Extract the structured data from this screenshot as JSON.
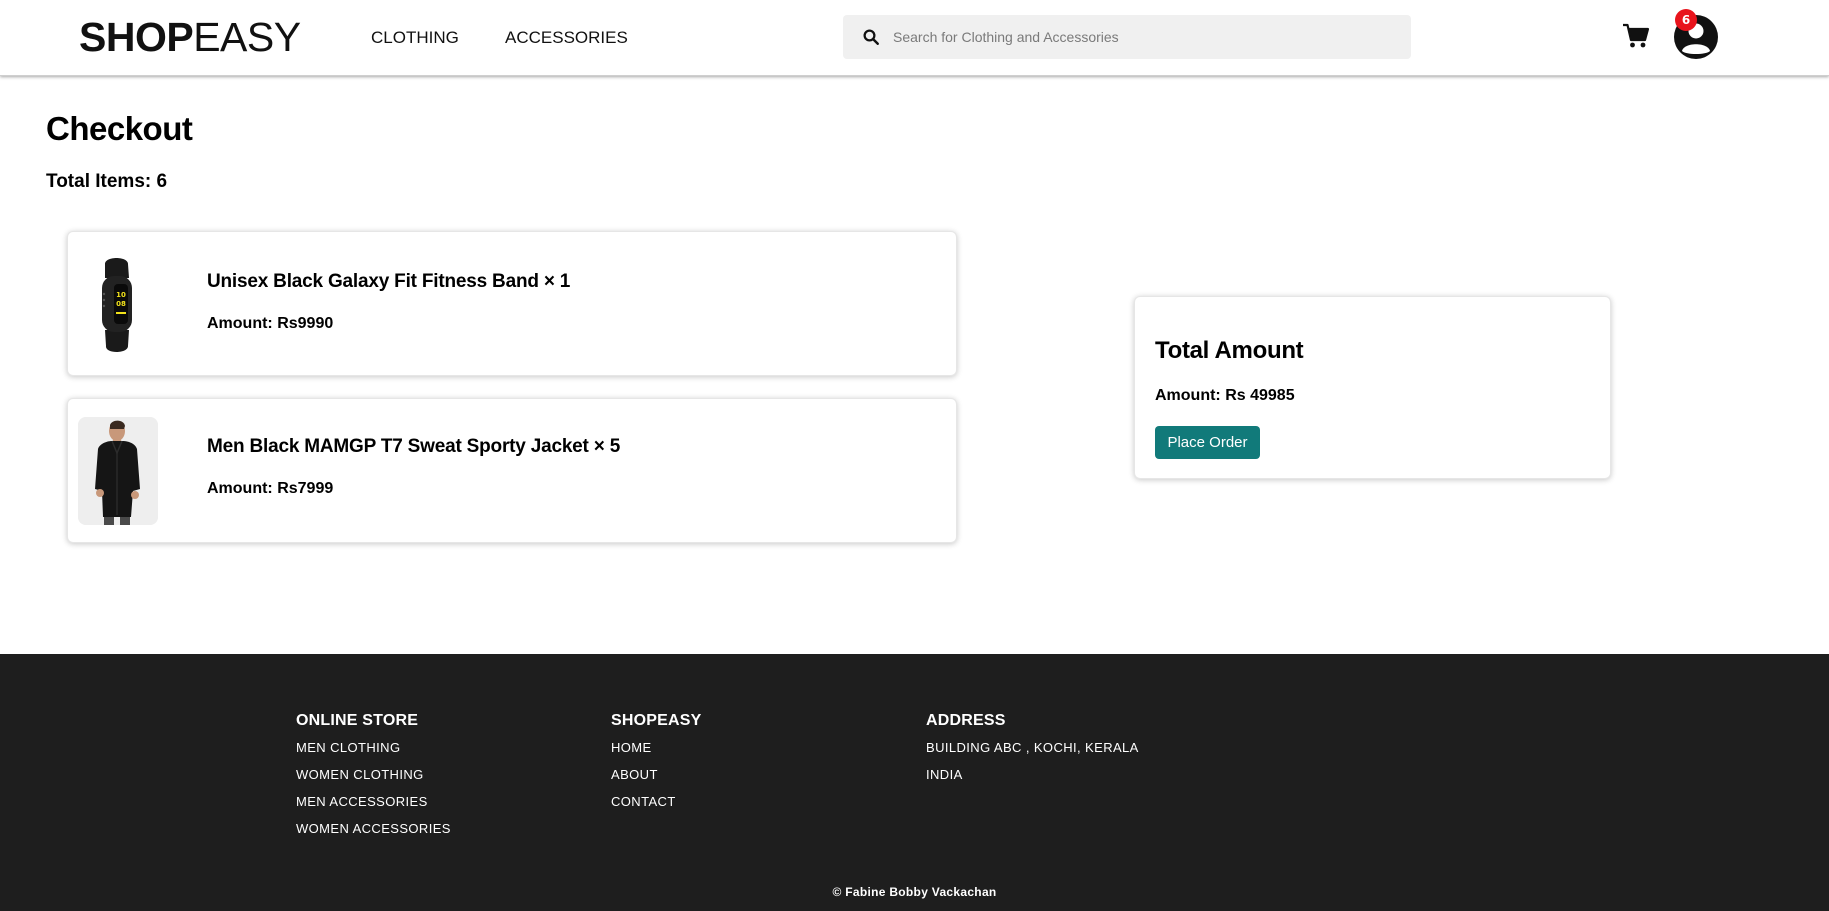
{
  "header": {
    "logo_bold": "SHOP",
    "logo_light": "EASY",
    "nav": [
      "CLOTHING",
      "ACCESSORIES"
    ],
    "search_placeholder": "Search for Clothing and Accessories",
    "cart_icon": "shopping-cart-icon",
    "profile_icon": "user-circle-icon",
    "badge_count": "6"
  },
  "main": {
    "title": "Checkout",
    "total_items": "Total Items: 6",
    "items": [
      {
        "name": "Unisex Black Galaxy Fit Fitness Band × 1",
        "amount": "Amount: Rs9990",
        "image": "fitness-band"
      },
      {
        "name": "Men Black MAMGP T7 Sweat Sporty Jacket × 5",
        "amount": "Amount: Rs7999",
        "image": "jacket"
      }
    ],
    "summary": {
      "title": "Total Amount",
      "amount": "Amount: Rs 49985",
      "button": "Place Order"
    }
  },
  "footer": {
    "online_store": {
      "heading": "ONLINE STORE",
      "links": [
        "MEN CLOTHING",
        "WOMEN CLOTHING",
        "MEN ACCESSORIES",
        "WOMEN ACCESSORIES"
      ]
    },
    "shopeasy": {
      "heading": "SHOPEASY",
      "links": [
        "HOME",
        "ABOUT",
        "CONTACT"
      ]
    },
    "address": {
      "heading": "ADDRESS",
      "lines": [
        "BUILDING ABC , KOCHI, KERALA",
        "INDIA"
      ]
    },
    "copyright": "© Fabine Bobby Vackachan"
  },
  "colors": {
    "accent": "#117a7a",
    "badge": "#e8141c",
    "footer_bg": "#1e1e1e",
    "search_bg": "#f0f0f0"
  }
}
